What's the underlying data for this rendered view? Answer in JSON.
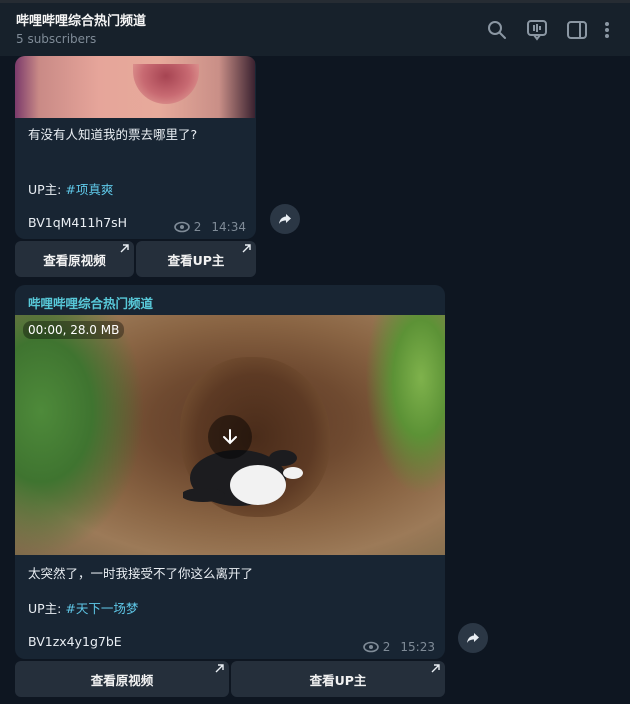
{
  "header": {
    "title": "哔哩哔哩综合热门频道",
    "subtitle": "5 subscribers",
    "icons": [
      "search-icon",
      "live-chat-icon",
      "sidebar-toggle-icon",
      "more-icon"
    ]
  },
  "messages": [
    {
      "caption": "有没有人知道我的票去哪里了?",
      "up_label": "UP主: ",
      "up_tag": "#项真爽",
      "bv": "BV1qM411h7sH",
      "views": "2",
      "time": "14:34",
      "buttons": [
        "查看原视频",
        "查看UP主"
      ]
    },
    {
      "sender": "哔哩哔哩综合热门频道",
      "media_info": "00:00, 28.0 MB",
      "caption": "太突然了，一时我接受不了你这么离开了",
      "up_label": "UP主: ",
      "up_tag": "#天下一场梦",
      "bv": "BV1zx4y1g7bE",
      "views": "2",
      "time": "15:23",
      "buttons": [
        "查看原视频",
        "查看UP主"
      ]
    }
  ],
  "colors": {
    "background": "#0e1621",
    "header": "#17212b",
    "bubble": "#182533",
    "button": "#252f3b",
    "hashtag": "#5fc8e8",
    "sender": "#58c9d9"
  }
}
